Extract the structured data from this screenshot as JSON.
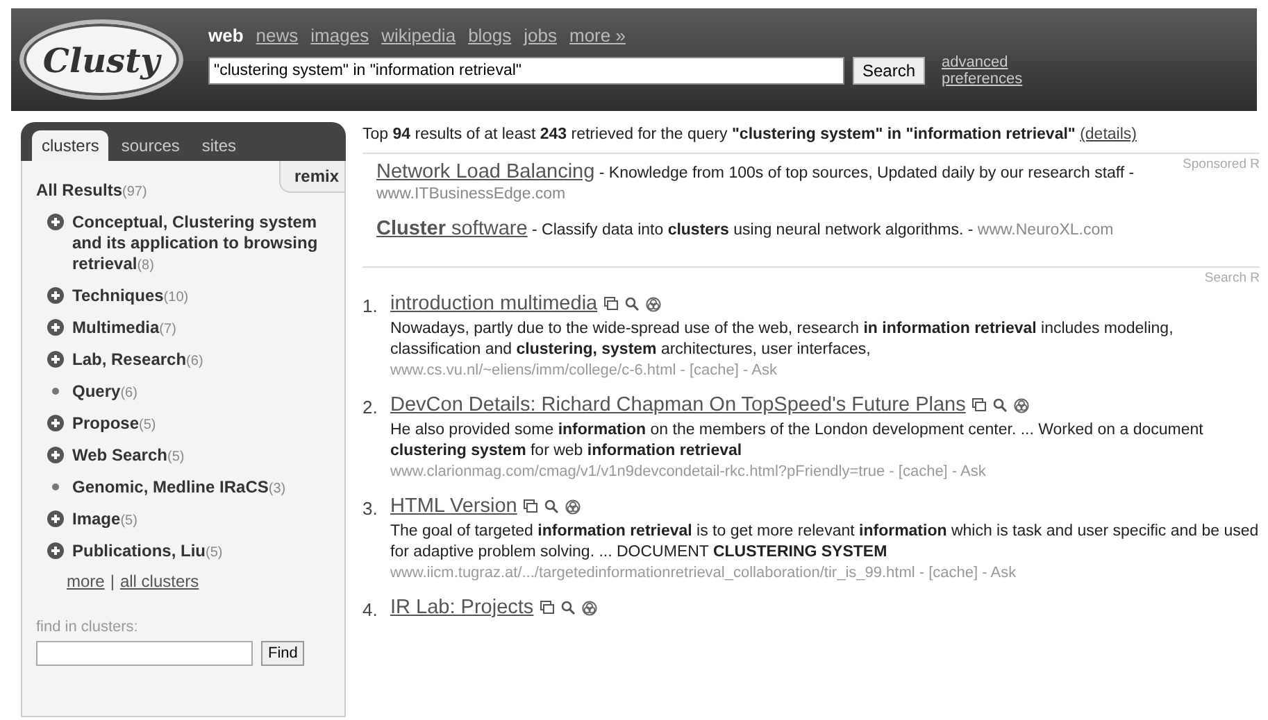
{
  "header": {
    "logo": "Clusty",
    "nav": [
      {
        "label": "web",
        "selected": true
      },
      {
        "label": "news",
        "selected": false
      },
      {
        "label": "images",
        "selected": false
      },
      {
        "label": "wikipedia",
        "selected": false
      },
      {
        "label": "blogs",
        "selected": false
      },
      {
        "label": "jobs",
        "selected": false
      },
      {
        "label": "more »",
        "selected": false
      }
    ],
    "search_value": "\"clustering system\" in \"information retrieval\"",
    "search_button": "Search",
    "advanced_link": "advanced preferences"
  },
  "sidebar": {
    "tabs": [
      {
        "label": "clusters",
        "selected": true
      },
      {
        "label": "sources",
        "selected": false
      },
      {
        "label": "sites",
        "selected": false
      }
    ],
    "remix": "remix",
    "all_results": {
      "label": "All Results",
      "count": "(97)"
    },
    "clusters": [
      {
        "label": "Conceptual, Clustering system and its application to browsing retrieval",
        "count": "(8)",
        "kind": "expandable"
      },
      {
        "label": "Techniques",
        "count": "(10)",
        "kind": "expandable"
      },
      {
        "label": "Multimedia",
        "count": "(7)",
        "kind": "expandable"
      },
      {
        "label": "Lab, Research",
        "count": "(6)",
        "kind": "expandable"
      },
      {
        "label": "Query",
        "count": "(6)",
        "kind": "leaf"
      },
      {
        "label": "Propose",
        "count": "(5)",
        "kind": "expandable"
      },
      {
        "label": "Web Search",
        "count": "(5)",
        "kind": "expandable"
      },
      {
        "label": "Genomic, Medline IRaCS",
        "count": "(3)",
        "kind": "leaf"
      },
      {
        "label": "Image",
        "count": "(5)",
        "kind": "expandable"
      },
      {
        "label": "Publications, Liu",
        "count": "(5)",
        "kind": "expandable"
      }
    ],
    "more_link": "more",
    "separator": "|",
    "all_clusters_link": "all clusters",
    "find_label": "find in clusters:",
    "find_button": "Find"
  },
  "main": {
    "summary": "Top **94** results of at least **243** retrieved for the query **\"clustering system\" in \"information retrieval\"**",
    "details_link": "(details)",
    "sponsored_label": "Sponsored R",
    "ads": [
      {
        "title": "Network Load Balancing",
        "description": "- Knowledge from 100s of top sources, Updated daily by our research staff -",
        "url": "www.ITBusinessEdge.com"
      },
      {
        "title": "**Cluster** software",
        "description": "- Classify data into **clusters** using neural network algorithms. -",
        "url": "www.NeuroXL.com"
      }
    ],
    "results_label": "Search R",
    "results": [
      {
        "number": "1.",
        "title": "introduction multimedia",
        "snippet": "Nowadays, partly due to the wide-spread use of the web, research **in information retrieval** includes modeling, classification and **clustering, system** architectures, user interfaces,",
        "meta": "www.cs.vu.nl/~eliens/imm/college/c-6.html - [cache] - Ask"
      },
      {
        "number": "2.",
        "title": "DevCon Details: Richard Chapman On TopSpeed's Future Plans",
        "snippet": "He also provided some **information** on the members of the London development center. ... Worked on a document **clustering system** for web **information retrieval**",
        "meta": "www.clarionmag.com/cmag/v1/v1n9devcondetail-rkc.html?pFriendly=true - [cache] - Ask"
      },
      {
        "number": "3.",
        "title": "HTML Version",
        "snippet": "The goal of targeted **information retrieval** is to get more relevant **information** which is task and user specific and be used for adaptive problem solving. ... DOCUMENT **CLUSTERING SYSTEM**",
        "meta": "www.iicm.tugraz.at/.../targetedinformationretrieval_collaboration/tir_is_99.html - [cache] - Ask"
      },
      {
        "number": "4.",
        "title": "IR Lab: Projects"
      }
    ]
  }
}
